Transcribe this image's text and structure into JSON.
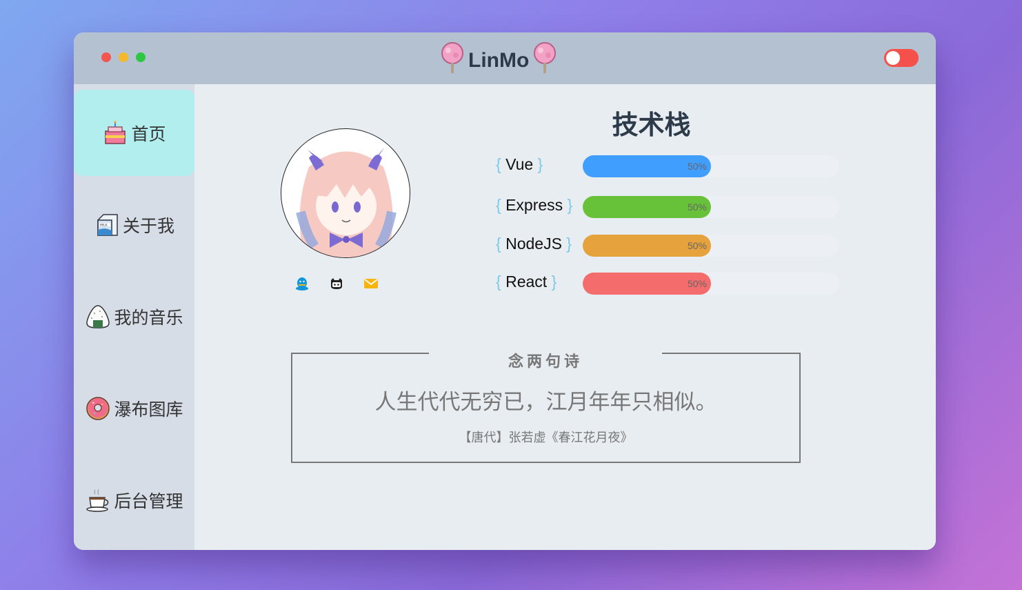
{
  "titlebar": {
    "brand": "LinMo",
    "theme_toggle_on": true
  },
  "sidebar": {
    "items": [
      {
        "label": "首页",
        "icon": "cake-icon",
        "active": true
      },
      {
        "label": "关于我",
        "icon": "milk-carton-icon",
        "active": false
      },
      {
        "label": "我的音乐",
        "icon": "rice-ball-icon",
        "active": false
      },
      {
        "label": "瀑布图库",
        "icon": "donut-icon",
        "active": false
      },
      {
        "label": "后台管理",
        "icon": "coffee-cup-icon",
        "active": false
      }
    ]
  },
  "profile": {
    "social": [
      {
        "icon": "qq-icon",
        "color": "#1296db"
      },
      {
        "icon": "github-icon",
        "color": "#222222"
      },
      {
        "icon": "mail-icon",
        "color": "#f6b40e"
      }
    ]
  },
  "skills": {
    "title": "技术栈",
    "items": [
      {
        "open": "{",
        "name": "Vue",
        "close": "}",
        "percent": 50,
        "label": "50%",
        "color": "#409eff"
      },
      {
        "open": "{",
        "name": "Express",
        "close": "}",
        "percent": 50,
        "label": "50%",
        "color": "#67c23a"
      },
      {
        "open": "{",
        "name": "NodeJS",
        "close": "}",
        "percent": 50,
        "label": "50%",
        "color": "#e6a23c"
      },
      {
        "open": "{",
        "name": "React",
        "close": "}",
        "percent": 50,
        "label": "50%",
        "color": "#f56c6c"
      }
    ]
  },
  "poem": {
    "heading": "念两句诗",
    "line": "人生代代无穷已，江月年年只相似。",
    "source": "【唐代】张若虚《春江花月夜》"
  }
}
